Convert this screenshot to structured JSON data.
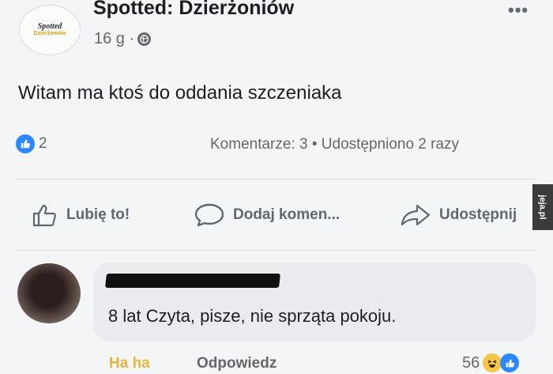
{
  "post": {
    "page_name": "Spotted: Dzierżoniów",
    "time": "16 g ·",
    "logo_text": "Spotted",
    "logo_subtext": "Dzierżoniów",
    "text": "Witam ma ktoś do oddania szczeniaka",
    "like_count": "2",
    "stats": "Komentarze: 3 • Udostępniono 2 razy"
  },
  "actions": {
    "like": "Lubię to!",
    "comment": "Dodaj komen...",
    "share": "Udostępnij"
  },
  "comment": {
    "text": "8 lat Czyta, pisze, nie sprząta pokoju.",
    "reaction_label": "Ha ha",
    "reply_label": "Odpowiedz",
    "reaction_count": "56"
  },
  "watermark": "jeja.pl",
  "icons": [
    "more-icon",
    "globe-icon",
    "like-badge-icon",
    "like-icon",
    "comment-icon",
    "share-icon",
    "haha-emoji-icon"
  ],
  "colors": {
    "accent": "#2d88ff",
    "haha": "#e8b53c",
    "muted": "#65676b"
  }
}
